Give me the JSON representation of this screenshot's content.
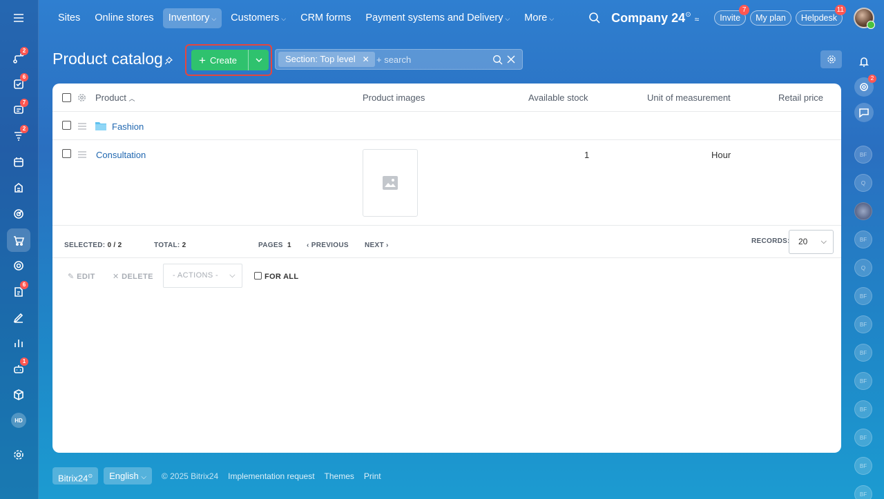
{
  "top_nav": {
    "items": [
      {
        "label": "Sites",
        "has_menu": false
      },
      {
        "label": "Online stores",
        "has_menu": false
      },
      {
        "label": "Inventory",
        "has_menu": true,
        "active": true
      },
      {
        "label": "Customers",
        "has_menu": true
      },
      {
        "label": "CRM forms",
        "has_menu": false
      },
      {
        "label": "Payment systems and Delivery",
        "has_menu": true
      },
      {
        "label": "More",
        "has_menu": true
      }
    ],
    "company": "Company 24",
    "company_mark": "⊙",
    "invite_label": "Invite",
    "invite_badge": "7",
    "myplan_label": "My plan",
    "helpdesk_label": "Helpdesk",
    "helpdesk_badge": "11"
  },
  "left_sidebar": {
    "badges": {
      "b1": "2",
      "b2": "6",
      "b3": "7",
      "b4": "2",
      "b5": "6",
      "b6": "1"
    },
    "hd_label": "HD"
  },
  "right_sidebar": {
    "badge": "2",
    "avatars": [
      "BF",
      "Q",
      "",
      "BF",
      "Q",
      "BF",
      "BF",
      "BF",
      "BF",
      "BF",
      "BF",
      "BF",
      "BF"
    ]
  },
  "page": {
    "title": "Product catalog",
    "create_label": "Create",
    "filter_tag": "Section: Top level",
    "search_placeholder": "+ search"
  },
  "table": {
    "headers": {
      "product": "Product",
      "images": "Product images",
      "stock": "Available stock",
      "unit": "Unit of measurement",
      "price": "Retail price"
    },
    "rows": [
      {
        "name": "Fashion",
        "type": "folder",
        "stock": "",
        "unit": ""
      },
      {
        "name": "Consultation",
        "type": "product",
        "stock": "1",
        "unit": "Hour"
      }
    ]
  },
  "pagination": {
    "selected_label": "SELECTED:",
    "selected_value": "0 / 2",
    "total_label": "TOTAL:",
    "total_value": "2",
    "pages_label": "PAGES",
    "pages_value": "1",
    "previous_label": "PREVIOUS",
    "next_label": "NEXT",
    "records_label": "RECORDS:",
    "records_value": "20"
  },
  "actions": {
    "edit_label": "EDIT",
    "delete_label": "DELETE",
    "actions_select": "- ACTIONS -",
    "for_all_label": "FOR ALL"
  },
  "footer": {
    "brand": "Bitrix24",
    "language": "English",
    "copyright": "© 2025 Bitrix24",
    "links": [
      "Implementation request",
      "Themes",
      "Print"
    ]
  },
  "colors": {
    "accent_green": "#2fc26e",
    "link_blue": "#2067b0",
    "badge_red": "#ff5752",
    "highlight_red": "#e8453c"
  }
}
